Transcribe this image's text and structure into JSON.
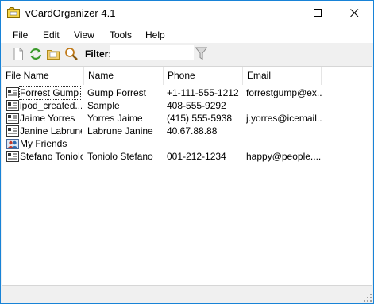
{
  "window": {
    "title": "vCardOrganizer 4.1"
  },
  "menu": [
    "File",
    "Edit",
    "View",
    "Tools",
    "Help"
  ],
  "toolbar": {
    "filter_label": "Filter:",
    "filter_value": ""
  },
  "columns": [
    "File Name",
    "Name",
    "Phone",
    "Email"
  ],
  "rows": [
    {
      "icon": "vcard-icon",
      "file": "Forrest Gump",
      "name": "Gump Forrest",
      "phone": "+1-111-555-1212",
      "email": "forrestgump@ex..."
    },
    {
      "icon": "vcard-icon",
      "file": "ipod_created...",
      "name": "Sample",
      "phone": "408-555-9292",
      "email": ""
    },
    {
      "icon": "vcard-icon",
      "file": "Jaime Yorres",
      "name": "Yorres Jaime",
      "phone": "(415) 555-5938",
      "email": "j.yorres@icemail...."
    },
    {
      "icon": "vcard-icon",
      "file": "Janine Labrune",
      "name": "Labrune Janine",
      "phone": "40.67.88.88",
      "email": ""
    },
    {
      "icon": "group-icon",
      "file": "My Friends",
      "name": "",
      "phone": "",
      "email": ""
    },
    {
      "icon": "vcard-icon",
      "file": "Stefano Toniolo",
      "name": "Toniolo Stefano",
      "phone": "001-212-1234",
      "email": "happy@people...."
    }
  ]
}
